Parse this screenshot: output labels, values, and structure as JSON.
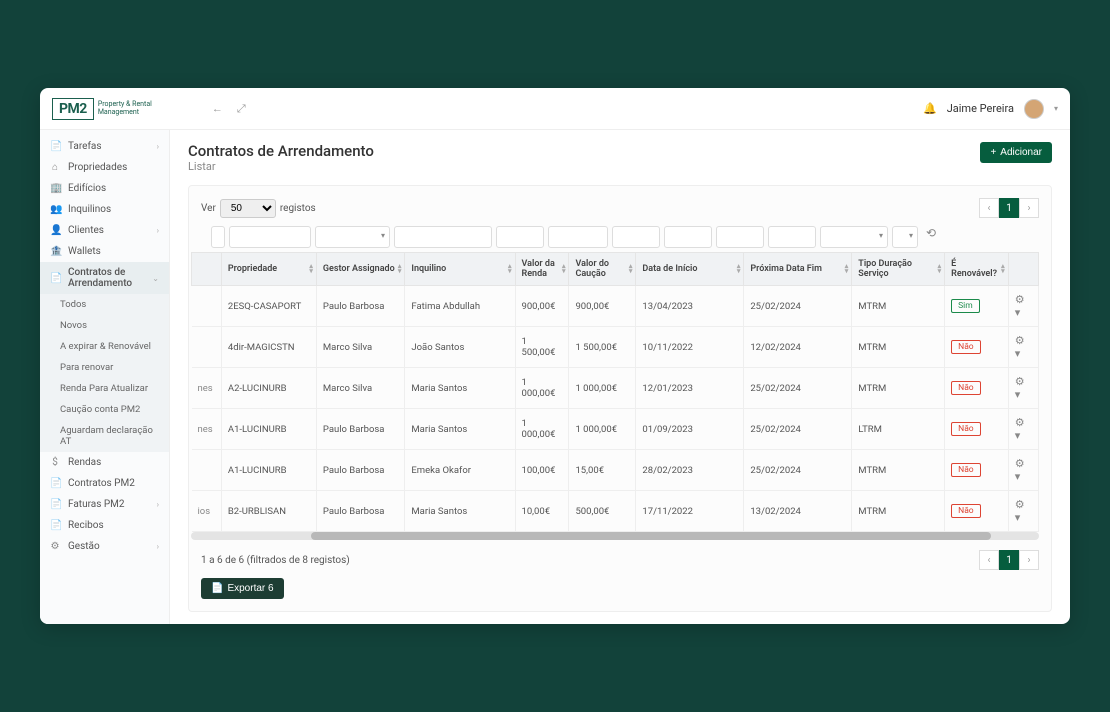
{
  "brand": {
    "logo": "PM2",
    "tagline1": "Property & Rental",
    "tagline2": "Management"
  },
  "user": {
    "name": "Jaime Pereira"
  },
  "sidebar": {
    "items": [
      {
        "label": "Tarefas",
        "icon": "📄",
        "chev": true
      },
      {
        "label": "Propriedades",
        "icon": "⌂"
      },
      {
        "label": "Edifícios",
        "icon": "🏢"
      },
      {
        "label": "Inquilinos",
        "icon": "👥"
      },
      {
        "label": "Clientes",
        "icon": "👤",
        "chev": true
      },
      {
        "label": "Wallets",
        "icon": "🏦"
      },
      {
        "label": "Contratos de Arrendamento",
        "icon": "📄",
        "active": true,
        "chev": true
      },
      {
        "label": "Rendas",
        "icon": "$"
      },
      {
        "label": "Contratos PM2",
        "icon": "📄"
      },
      {
        "label": "Faturas PM2",
        "icon": "📄",
        "chev": true
      },
      {
        "label": "Recibos",
        "icon": "📄"
      },
      {
        "label": "Gestão",
        "icon": "⚙",
        "chev": true
      }
    ],
    "sub": [
      "Todos",
      "Novos",
      "A expirar & Renovável",
      "Para renovar",
      "Renda Para Atualizar",
      "Caução conta PM2",
      "Aguardam declaração AT"
    ]
  },
  "page": {
    "title": "Contratos de Arrendamento",
    "subtitle": "Listar"
  },
  "actions": {
    "add": "Adicionar",
    "export": "Exportar 6"
  },
  "show": {
    "label": "Ver",
    "suffix": "registos",
    "value": "50"
  },
  "columns": [
    "Propriedade",
    "Gestor Assignado",
    "Inquilino",
    "Valor da Renda",
    "Valor do Caução",
    "Data de Início",
    "Próxima Data Fim",
    "Tipo Duração Serviço",
    "É Renovável?"
  ],
  "partial": [
    "nes",
    "nes",
    "ios"
  ],
  "rows": [
    {
      "prop": "2ESQ-CASAPORT",
      "gest": "Paulo Barbosa",
      "inq": "Fatima Abdullah",
      "renda": "900,00€",
      "caucao": "900,00€",
      "inicio": "13/04/2023",
      "fim": "25/02/2024",
      "tipo": "MTRM",
      "renov": "Sim",
      "partial": ""
    },
    {
      "prop": "4dir-MAGICSTN",
      "gest": "Marco Silva",
      "inq": "João Santos",
      "renda": "1 500,00€",
      "caucao": "1 500,00€",
      "inicio": "10/11/2022",
      "fim": "12/02/2024",
      "tipo": "MTRM",
      "renov": "Não",
      "partial": ""
    },
    {
      "prop": "A2-LUCINURB",
      "gest": "Marco Silva",
      "inq": "Maria Santos",
      "renda": "1 000,00€",
      "caucao": "1 000,00€",
      "inicio": "12/01/2023",
      "fim": "25/02/2024",
      "tipo": "MTRM",
      "renov": "Não",
      "partial": "nes"
    },
    {
      "prop": "A1-LUCINURB",
      "gest": "Paulo Barbosa",
      "inq": "Maria Santos",
      "renda": "1 000,00€",
      "caucao": "1 000,00€",
      "inicio": "01/09/2023",
      "fim": "25/02/2024",
      "tipo": "LTRM",
      "renov": "Não",
      "partial": "nes"
    },
    {
      "prop": "A1-LUCINURB",
      "gest": "Paulo Barbosa",
      "inq": "Emeka Okafor",
      "renda": "100,00€",
      "caucao": "15,00€",
      "inicio": "28/02/2023",
      "fim": "25/02/2024",
      "tipo": "MTRM",
      "renov": "Não",
      "partial": ""
    },
    {
      "prop": "B2-URBLISAN",
      "gest": "Paulo Barbosa",
      "inq": "Maria Santos",
      "renda": "10,00€",
      "caucao": "500,00€",
      "inicio": "17/11/2022",
      "fim": "13/02/2024",
      "tipo": "MTRM",
      "renov": "Não",
      "partial": "ios"
    }
  ],
  "info": "1 a 6 de 6 (filtrados de 8 registos)",
  "pagination": {
    "current": "1"
  }
}
